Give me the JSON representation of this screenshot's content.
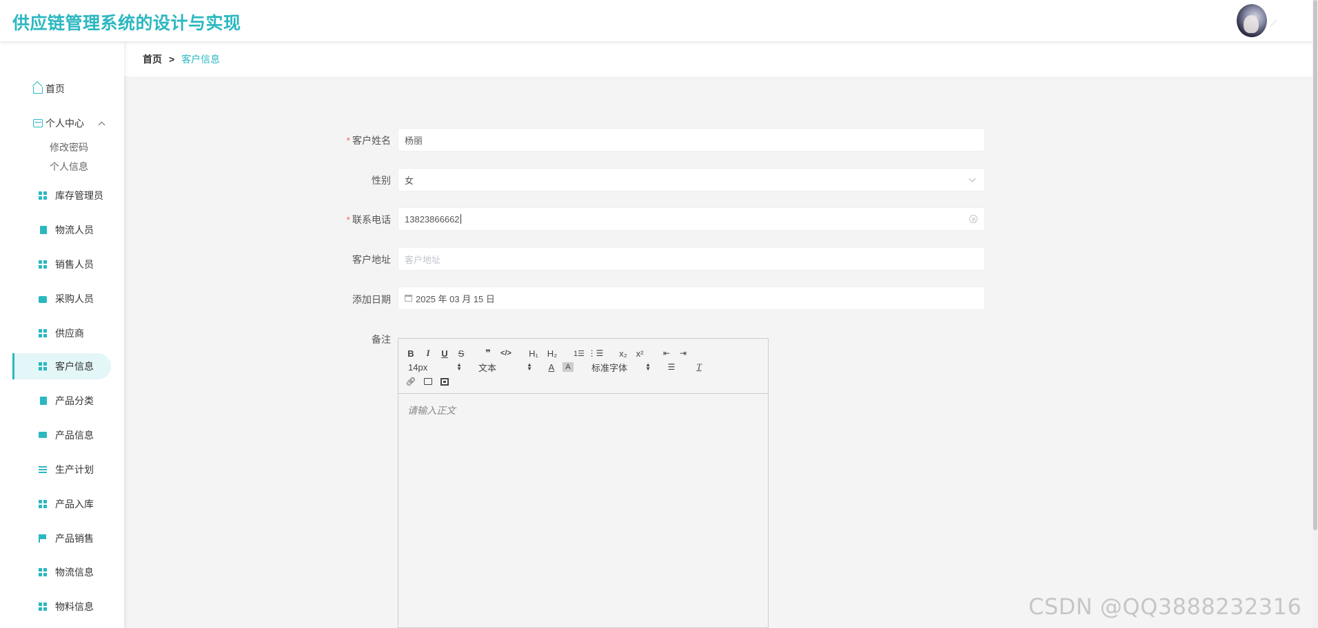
{
  "header": {
    "title": "供应链管理系统的设计与实现"
  },
  "sidebar": {
    "home": "首页",
    "personal_center": "个人中心",
    "personal_sub": [
      "修改密码",
      "个人信息"
    ],
    "items": [
      {
        "label": "库存管理员",
        "icon": "grid-icon"
      },
      {
        "label": "物流人员",
        "icon": "clipboard-icon"
      },
      {
        "label": "销售人员",
        "icon": "grid-icon"
      },
      {
        "label": "采购人员",
        "icon": "briefcase-icon"
      },
      {
        "label": "供应商",
        "icon": "grid-icon"
      },
      {
        "label": "客户信息",
        "icon": "grid-icon",
        "active": true
      },
      {
        "label": "产品分类",
        "icon": "clipboard-icon"
      },
      {
        "label": "产品信息",
        "icon": "monitor-icon"
      },
      {
        "label": "生产计划",
        "icon": "list-icon"
      },
      {
        "label": "产品入库",
        "icon": "grid-icon"
      },
      {
        "label": "产品销售",
        "icon": "flag-icon"
      },
      {
        "label": "物流信息",
        "icon": "grid-icon"
      },
      {
        "label": "物料信息",
        "icon": "grid-icon"
      }
    ]
  },
  "breadcrumb": {
    "home": "首页",
    "sep": ">",
    "current": "客户信息"
  },
  "form": {
    "name_label": "客户姓名",
    "name_value": "杨丽",
    "gender_label": "性别",
    "gender_value": "女",
    "phone_label": "联系电话",
    "phone_value": "13823866662",
    "address_label": "客户地址",
    "address_placeholder": "客户地址",
    "date_label": "添加日期",
    "date_value": "2025 年 03 月 15 日",
    "remark_label": "备注",
    "required_mark": "*"
  },
  "editor": {
    "toolbar_row1": [
      "B",
      "I",
      "U",
      "S",
      "❞",
      "</>",
      "H₁",
      "H₂",
      "ordered-list-icon",
      "bullet-list-icon",
      "x₂",
      "x²",
      "outdent-icon",
      "indent-icon"
    ],
    "font_size": "14px",
    "header_select": "文本",
    "font_select": "标准字体",
    "placeholder": "请输入正文"
  },
  "watermark": "CSDN @QQ3888232316",
  "colors": {
    "accent": "#2bb7c0",
    "required": "#f56c6c"
  }
}
